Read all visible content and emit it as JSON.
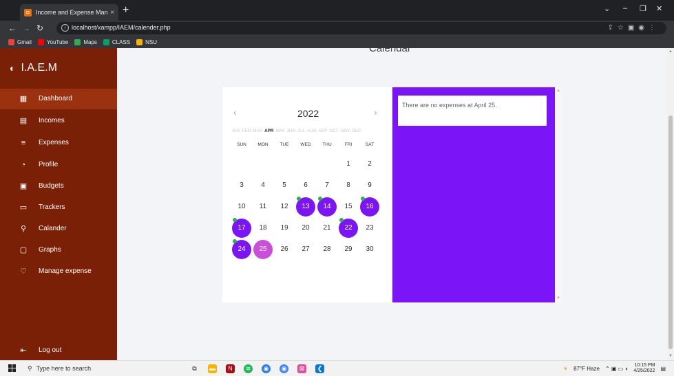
{
  "browser": {
    "tab_title": "Income and Expense Manageme...",
    "tab_close": "×",
    "new_tab": "+",
    "url": "localhost/xampp/IAEM/calender.php",
    "bookmarks": [
      {
        "label": "Gmail",
        "icon": "gmail-icon",
        "color": "#ea4335"
      },
      {
        "label": "YouTube",
        "icon": "youtube-icon",
        "color": "#ff0000"
      },
      {
        "label": "Maps",
        "icon": "maps-icon",
        "color": "#34a853"
      },
      {
        "label": "CLASS",
        "icon": "class-icon",
        "color": "#0f9d58"
      },
      {
        "label": "NSU",
        "icon": "nsu-icon",
        "color": "#f4b400"
      }
    ]
  },
  "page": {
    "cut_title": "Calendar"
  },
  "sidebar": {
    "brand": "I.A.E.M",
    "items": [
      {
        "label": "Dashboard",
        "icon": "dashboard-icon",
        "glyph": "▦",
        "active": true
      },
      {
        "label": "Incomes",
        "icon": "incomes-icon",
        "glyph": "▤"
      },
      {
        "label": "Expenses",
        "icon": "expenses-icon",
        "glyph": "≡"
      },
      {
        "label": "Profile",
        "icon": "profile-icon",
        "glyph": "◔"
      },
      {
        "label": "Budgets",
        "icon": "budgets-icon",
        "glyph": "▣"
      },
      {
        "label": "Trackers",
        "icon": "trackers-icon",
        "glyph": "▭"
      },
      {
        "label": "Calander",
        "icon": "user-icon",
        "glyph": "⚲"
      },
      {
        "label": "Graphs",
        "icon": "graphs-icon",
        "glyph": "▢"
      },
      {
        "label": "Manage expense",
        "icon": "heart-icon",
        "glyph": "♡"
      }
    ],
    "logout": "Log out"
  },
  "calendar": {
    "year": "2022",
    "prev": "‹",
    "next": "›",
    "months": [
      "JAN",
      "FEB",
      "MAR",
      "APR",
      "MAY",
      "JUN",
      "JUL",
      "AUG",
      "SEP",
      "OCT",
      "NOV",
      "DEC"
    ],
    "current_month": "APR",
    "weekdays": [
      "SUN",
      "MON",
      "TUE",
      "WED",
      "THU",
      "FRI",
      "SAT"
    ],
    "first_weekday": 5,
    "days_in_month": 30,
    "expense_days": [
      13,
      14,
      16,
      17,
      22,
      24
    ],
    "selected_day": 25,
    "colors": {
      "expense": "#7b14f6",
      "selected": "#c94fd8",
      "dot": "#2ab24a"
    }
  },
  "panel": {
    "message": "There are no expenses at April 25."
  },
  "taskbar": {
    "search_placeholder": "Type here to search",
    "weather": "87°F Haze",
    "time": "10:15 PM",
    "date": "4/25/2022"
  }
}
